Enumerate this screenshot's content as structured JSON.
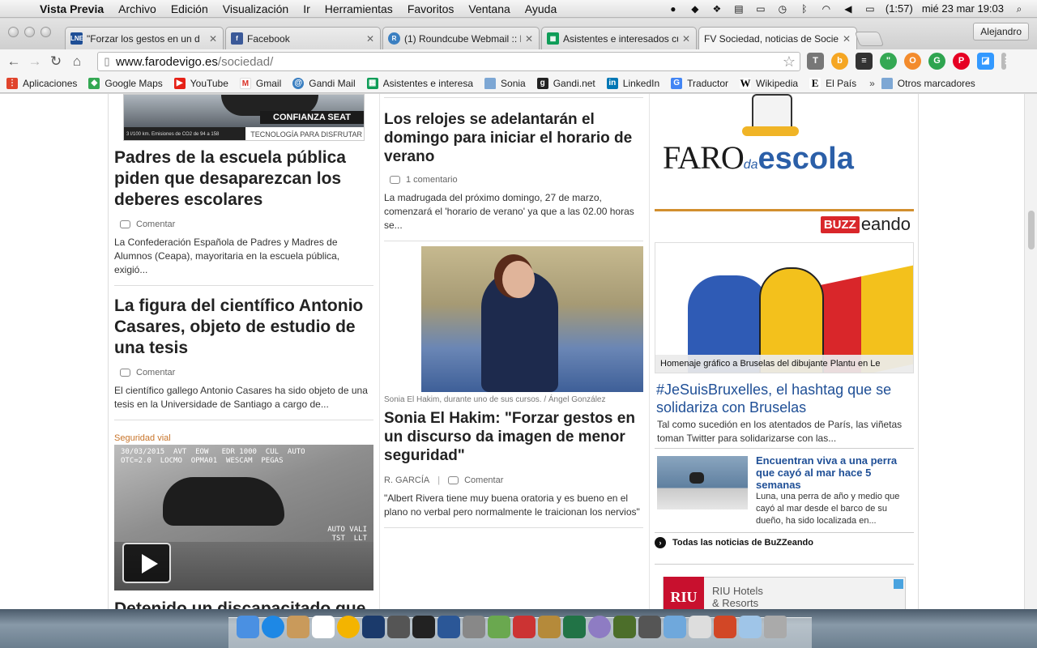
{
  "menubar": {
    "app_name": "Vista Previa",
    "items": [
      "Archivo",
      "Edición",
      "Visualización",
      "Ir",
      "Herramientas",
      "Favoritos",
      "Ventana",
      "Ayuda"
    ],
    "battery": "(1:57)",
    "clock": "mié 23 mar  19:03"
  },
  "tabs": [
    {
      "title": "\"Forzar los gestos en un d",
      "favicon": "LNE",
      "color": "#1f4f96"
    },
    {
      "title": "Facebook",
      "favicon": "f",
      "color": "#3b5998"
    },
    {
      "title": "(1) Roundcube Webmail :: N",
      "favicon": "R",
      "color": "#3a7fc1"
    },
    {
      "title": "Asistentes e interesados cu",
      "favicon": "▦",
      "color": "#0f9d58"
    },
    {
      "title": "FV Sociedad, noticias de Socie",
      "favicon": "FV",
      "color": "#ffffff"
    }
  ],
  "profile_name": "Alejandro",
  "url": {
    "host": "www.farodevigo.es",
    "path": "/sociedad/"
  },
  "bookmarks": [
    {
      "label": "Aplicaciones",
      "icon": "apps-grid-icon",
      "color": "#e0442c"
    },
    {
      "label": "Google Maps",
      "icon": "maps-pin-icon",
      "color": "#34a853"
    },
    {
      "label": "YouTube",
      "icon": "youtube-icon",
      "color": "#e62117"
    },
    {
      "label": "Gmail",
      "icon": "gmail-icon",
      "color": "#d93025"
    },
    {
      "label": "Gandi Mail",
      "icon": "gandi-mail-icon",
      "color": "#3a7fc1"
    },
    {
      "label": "Asistentes e interesa",
      "icon": "sheets-icon",
      "color": "#0f9d58"
    },
    {
      "label": "Sonia",
      "icon": "folder-icon",
      "color": "#7da7d4"
    },
    {
      "label": "Gandi.net",
      "icon": "gandi-icon",
      "color": "#222222"
    },
    {
      "label": "LinkedIn",
      "icon": "linkedin-icon",
      "color": "#0077b5"
    },
    {
      "label": "Traductor",
      "icon": "translate-icon",
      "color": "#4285f4"
    },
    {
      "label": "Wikipedia",
      "icon": "wikipedia-icon",
      "color": "#000000"
    },
    {
      "label": "El País",
      "icon": "elpais-icon",
      "color": "#000000"
    }
  ],
  "bookmarks_more": "»",
  "bookmarks_other": "Otros marcadores",
  "ad_seat": {
    "confianza": "CONFIANZA SEAT",
    "emissions": "3 l/100 km. Emisiones de CO2 de 94 a 158",
    "tagline": "TECNOLOGÍA PARA DISFRUTAR"
  },
  "left_col": {
    "articles": [
      {
        "headline": "Padres de la escuela pública piden que desaparezcan los deberes escolares",
        "comments": "Comentar",
        "excerpt": "La Confederación Española de Padres y Madres de Alumnos (Ceapa), mayoritaria en la escuela pública, exigió..."
      },
      {
        "headline": "La figura del científico Antonio Casares, objeto de estudio de una tesis",
        "comments": "Comentar",
        "excerpt": "El científico gallego Antonio Casares ha sido objeto de una tesis en la Universidade de Santiago a cargo de..."
      }
    ],
    "video_section": "Seguridad vial",
    "video_osd_top": "30/03/2015  AVT  EOW   EDR 1000  CUL  AUTO  \nOTC=2.0  LOCMO  OPMA01  WESCAM  PEGAS",
    "video_osd_side": "AUTO VALI\nTST  LLT",
    "video_headline": "Detenido un discapacitado que conducía un Porsche a"
  },
  "mid_col": {
    "article1": {
      "headline": "Los relojes se adelantarán el domingo para iniciar el horario de verano",
      "comments": "1 comentario",
      "excerpt": "La madrugada del próximo domingo, 27 de marzo, comenzará el 'horario de verano' ya que a las 02.00 horas se..."
    },
    "photo_caption": "Sonia El Hakim, durante uno de sus cursos. / Ángel González",
    "article2": {
      "headline": "Sonia El Hakim: \"Forzar gestos en un discurso da imagen de menor seguridad\"",
      "author": "R. GARCÍA",
      "sep": "|",
      "comments": "Comentar",
      "excerpt": "\"Albert Rivera tiene muy buena oratoria y es bueno en el plano no verbal pero normalmente le traicionan los nervios\""
    }
  },
  "right_col": {
    "faro": "FARO",
    "da": "da",
    "escola": "escola",
    "buzz": "BUZZ",
    "eando": "eando",
    "buzz_caption": "Homenaje gráfico a Bruselas del dibujante Plantu en Le",
    "buzz_title": "#JeSuisBruxelles, el hashtag que se solidariza con Bruselas",
    "buzz_excerpt": "Tal como sucedión en los atentados de París, las viñetas toman Twitter para solidarizarse con las...",
    "dog_title": "Encuentran viva a una perra que cayó al mar hace 5 semanas",
    "dog_excerpt": "Luna, una perra de año y medio que cayó al mar desde el barco de su dueño, ha sido localizada en...",
    "all_news": "Todas las noticias de BuZZeando",
    "riu_logo": "RIU",
    "riu_text1": "RIU Hotels",
    "riu_text2": "& Resorts"
  },
  "dock": [
    "Finder",
    "App Store",
    "Contactos",
    "Calendario",
    "Chrome",
    "Photoshop",
    "iMovie",
    "Terminal",
    "Word",
    "Utilidad",
    "Mapas",
    "Reloj",
    "Preview",
    "Excel",
    "Safari",
    "Dreamweaver",
    "Maps",
    "iPhoto",
    "TextEdit",
    "PowerPoint",
    "Aplicaciones",
    "Papelera"
  ]
}
